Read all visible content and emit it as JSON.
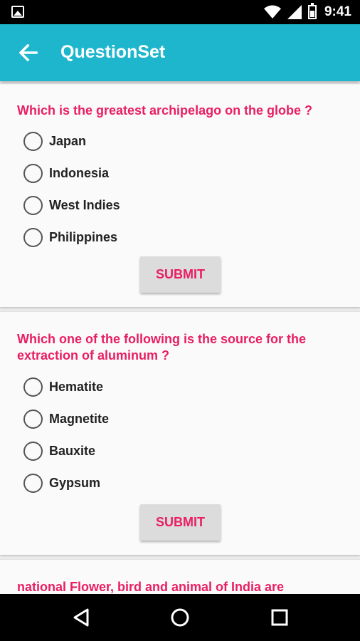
{
  "status_bar": {
    "time": "9:41"
  },
  "app_bar": {
    "title": "QuestionSet"
  },
  "questions": [
    {
      "text": "Which is the greatest archipelago on the globe ?",
      "options": [
        "Japan",
        "Indonesia",
        "West Indies",
        "Philippines"
      ],
      "submit_label": "SUBMIT"
    },
    {
      "text": "Which one of the following is the source for the extraction of aluminum ?",
      "options": [
        "Hematite",
        "Magnetite",
        "Bauxite",
        "Gypsum"
      ],
      "submit_label": "SUBMIT"
    },
    {
      "text": "national Flower, bird and animal of India are"
    }
  ],
  "colors": {
    "app_bar": "#1db6cd",
    "accent": "#e91e63"
  },
  "icons": {
    "back": "arrow-back-icon",
    "gallery": "gallery-icon",
    "wifi": "wifi-icon",
    "signal": "signal-icon",
    "battery": "battery-icon",
    "nav_back": "nav-back-icon",
    "nav_home": "nav-home-icon",
    "nav_recent": "nav-recent-icon"
  }
}
